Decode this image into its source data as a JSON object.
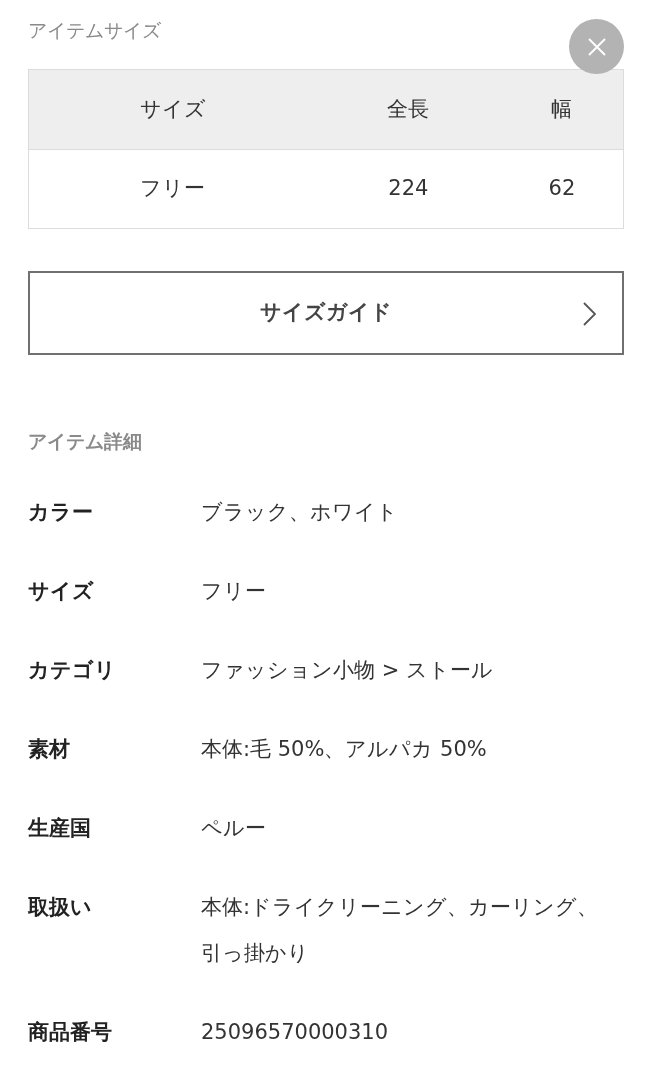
{
  "size_section": {
    "title": "アイテムサイズ"
  },
  "size_table": {
    "columns": [
      "サイズ",
      "全長",
      "幅"
    ],
    "rows": [
      [
        "フリー",
        "224",
        "62"
      ]
    ]
  },
  "size_guide_button": {
    "label": "サイズガイド"
  },
  "details_section": {
    "title": "アイテム詳細"
  },
  "details": [
    {
      "label": "カラー",
      "value": "ブラック、ホワイト"
    },
    {
      "label": "サイズ",
      "value": "フリー"
    },
    {
      "label": "カテゴリ",
      "value": "ファッション小物 > ストール"
    },
    {
      "label": "素材",
      "value": "本体:毛 50%、アルパカ 50%"
    },
    {
      "label": "生産国",
      "value": "ペルー"
    },
    {
      "label": "取扱い",
      "value": "本体:ドライクリーニング、カーリング、引っ掛かり"
    },
    {
      "label": "商品番号",
      "value": "25096570000310"
    }
  ]
}
